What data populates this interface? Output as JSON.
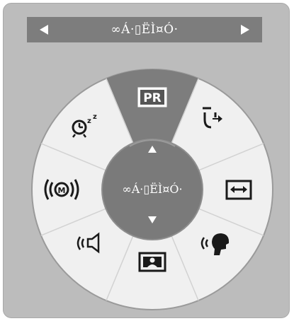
{
  "header": {
    "title": "∞Á·▯ËÌ¤Ó·",
    "prev_icon": "triangle-left-icon",
    "next_icon": "triangle-right-icon"
  },
  "center": {
    "label": "∞Á·▯ËÌ¤Ó·",
    "up_icon": "triangle-up-icon",
    "down_icon": "triangle-down-icon"
  },
  "items": [
    {
      "id": "pr",
      "label": "PR",
      "icon": "pr-icon",
      "selected": true
    },
    {
      "id": "input",
      "icon": "input-arrow-icon"
    },
    {
      "id": "aspect",
      "icon": "aspect-ratio-icon"
    },
    {
      "id": "voice",
      "icon": "speaking-head-icon"
    },
    {
      "id": "picture",
      "icon": "picture-mode-icon"
    },
    {
      "id": "sound",
      "icon": "speaker-icon"
    },
    {
      "id": "mode",
      "icon": "m-broadcast-icon"
    },
    {
      "id": "sleep",
      "icon": "sleep-timer-icon"
    }
  ],
  "colors": {
    "panel": "#bcbcbc",
    "header": "#7d7d7d",
    "wheel": "#f0f0f0",
    "selected_segment": "#7d7d7d",
    "center": "#7a7a7a"
  }
}
